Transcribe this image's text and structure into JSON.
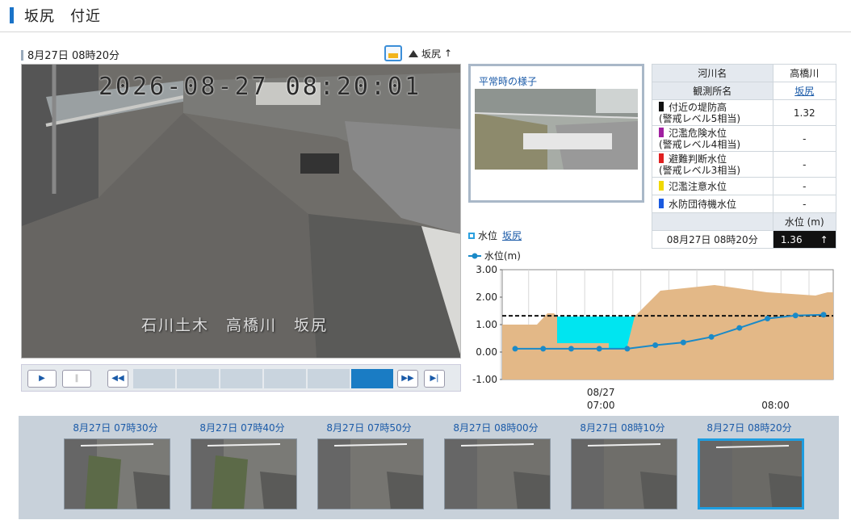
{
  "header": {
    "title": "坂尻　付近"
  },
  "camera": {
    "datetime_label": "8月27日 08時20分",
    "location_link": "坂尻",
    "link_arrow": "↑",
    "timestamp_overlay": "2026-08-27  08:20:01",
    "caption_overlay": "石川土木　高橋川　坂尻"
  },
  "normal_view": {
    "label": "平常時の様子"
  },
  "info_table": {
    "river_name_label": "河川名",
    "river_name_value": "高橋川",
    "station_label": "観測所名",
    "station_value": "坂尻",
    "levels": [
      {
        "line1": "付近の堤防高",
        "line2": "(警戒レベル5相当)",
        "value": "1.32",
        "color": "#111111"
      },
      {
        "line1": "氾濫危険水位",
        "line2": "(警戒レベル4相当)",
        "value": "-",
        "color": "#a020a0"
      },
      {
        "line1": "避難判断水位",
        "line2": "(警戒レベル3相当)",
        "value": "-",
        "color": "#e02020"
      },
      {
        "line1": "氾濫注意水位",
        "line2": "",
        "value": "-",
        "color": "#f0d800"
      },
      {
        "line1": "水防団待機水位",
        "line2": "",
        "value": "-",
        "color": "#1a5ae0"
      }
    ],
    "level_header": "水位 (m)",
    "current_time": "08月27日 08時20分",
    "current_value": "1.36",
    "current_arrow": "↑"
  },
  "chart_legend": {
    "series_label": "水位",
    "station_link": "坂尻",
    "line_label": "水位(m)"
  },
  "chart_data": {
    "type": "line",
    "ylabel": "水位(m)",
    "ylim": [
      -1.0,
      3.0
    ],
    "y_ticks": [
      "3.00",
      "2.00",
      "1.00",
      "0.00",
      "-1.00"
    ],
    "x_ticks": [
      {
        "line1": "08/27",
        "line2": "07:00"
      },
      {
        "line1": "",
        "line2": "08:00"
      }
    ],
    "levee_height": 1.32,
    "series": [
      {
        "name": "水位",
        "x": [
          "06:30",
          "06:40",
          "06:50",
          "07:00",
          "07:10",
          "07:20",
          "07:30",
          "07:40",
          "07:50",
          "08:00",
          "08:10",
          "08:20"
        ],
        "values": [
          0.12,
          0.12,
          0.12,
          0.12,
          0.12,
          0.25,
          0.35,
          0.55,
          0.88,
          1.22,
          1.33,
          1.36
        ]
      }
    ],
    "colors": {
      "line": "#1a8ac8",
      "ground": "#e3b887",
      "water": "#00e5f0",
      "levee": "#111111"
    }
  },
  "thumbnails": [
    {
      "label": "8月27日 07時30分"
    },
    {
      "label": "8月27日 07時40分"
    },
    {
      "label": "8月27日 07時50分"
    },
    {
      "label": "8月27日 08時00分"
    },
    {
      "label": "8月27日 08時10分"
    },
    {
      "label": "8月27日 08時20分",
      "selected": true
    }
  ],
  "player": {
    "play": "▶",
    "pause": "‖",
    "rewind": "◀◀",
    "forward": "▶▶",
    "end": "▶|"
  }
}
